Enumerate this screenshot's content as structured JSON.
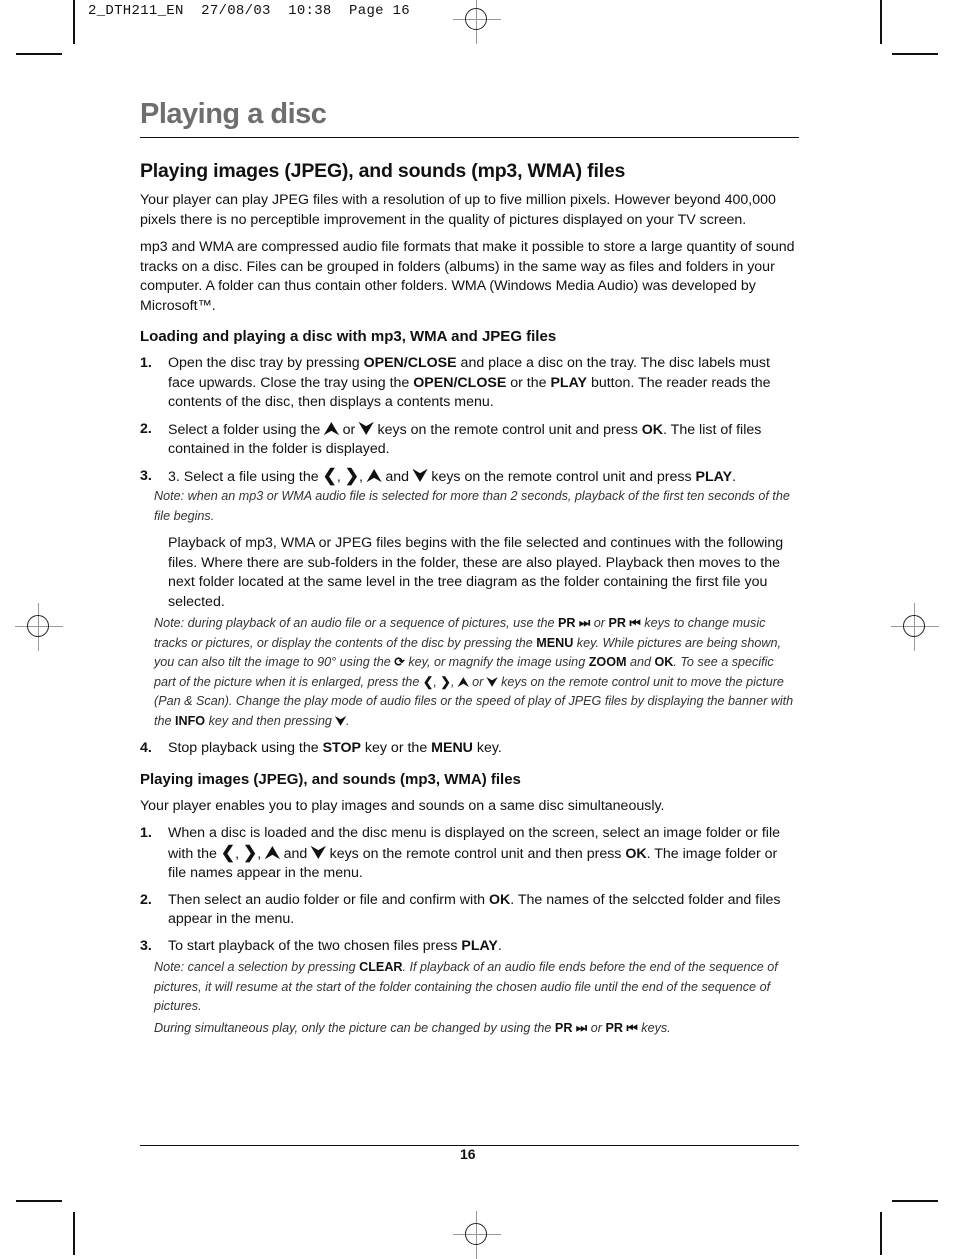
{
  "slug": "2_DTH211_EN  27/08/03  10:38  Page 16",
  "page_title": "Playing a disc",
  "section1": {
    "heading": "Playing images (JPEG), and sounds (mp3, WMA) files",
    "para1": "Your player can play JPEG files with a resolution of up to five million pixels. However beyond 400,000 pixels there is no perceptible improvement in the quality of pictures displayed on your TV screen.",
    "para2": "mp3 and WMA are compressed audio file formats that make it possible to store a large quantity of sound tracks on a disc. Files can be grouped in folders (albums) in the same way as files and folders in your computer. A folder can thus contain other folders. WMA (Windows Media Audio) was developed by Microsoft™."
  },
  "section2": {
    "heading": "Loading and playing a disc with mp3, WMA and JPEG files",
    "step1": {
      "num": "1.",
      "a": "Open the disc tray by pressing ",
      "k1": "OPEN/CLOSE",
      "b": " and place a disc on the tray. The disc labels must face upwards. Close the tray using the ",
      "k2": "OPEN/CLOSE",
      "c": " or the ",
      "k3": "PLAY",
      "d": " button. The reader reads the contents of the disc, then displays a contents menu."
    },
    "step2": {
      "num": "2.",
      "a": "Select a folder using the ",
      "up": "⮝",
      "or": " or ",
      "down": "⮟",
      "b": " keys on the remote control unit and press ",
      "k1": "OK",
      "c": ". The list of files contained in the folder is displayed."
    },
    "step3": {
      "num": "3.",
      "a": "3. Select a file using the ",
      "left": "❮",
      "right": "❯",
      "up": "⮝",
      "and": " and ",
      "down": "⮟",
      "b": " keys on the remote control unit and press ",
      "k1": "PLAY",
      "c": "."
    },
    "note1": "Note: when an mp3 or WMA audio file is selected for more than 2 seconds, playback of the first ten seconds of the file begins.",
    "para3": "Playback of mp3, WMA or JPEG files begins with the file selected and continues with the following files. Where there are sub-folders in the folder, these are also played. Playback then moves to the next folder located at the same level in the tree diagram as the folder containing the first file you selected.",
    "note2": {
      "a": "Note: during playback of an audio file or a sequence of pictures, use the ",
      "k1": "PR ⏭",
      "b": " or ",
      "k2": "PR ⏮",
      "c": " keys to change music tracks or pictures, or display the contents of the disc by pressing the ",
      "k3": "MENU",
      "d": " key. While pictures are being shown, you can also tilt the image to 90° using the ",
      "rotate_icon": "⟳",
      "e": " key, or magnify the image using ",
      "k4": "ZOOM",
      "f": " and ",
      "k5": "OK",
      "g": ". To see a specific part of the picture when it is enlarged, press the ",
      "left": "❮",
      "right": "❯",
      "up": "⮝",
      "or": " or ",
      "down": "⮟",
      "h": " keys on the remote control unit to move the picture (Pan & Scan). Change the play mode of audio files or the speed of play of JPEG files by displaying the banner with the ",
      "k6": "INFO",
      "i": " key and then pressing ",
      "j": "."
    },
    "step4": {
      "num": "4.",
      "a": "Stop playback using the ",
      "k1": "STOP",
      "b": " key or the ",
      "k2": "MENU",
      "c": " key."
    }
  },
  "section3": {
    "heading": "Playing images (JPEG), and sounds (mp3, WMA) files",
    "para": "Your player enables you to play images and sounds on a same disc simultaneously.",
    "step1": {
      "num": "1.",
      "a": "When a disc is loaded and the disc menu is displayed on the screen, select an image folder or file with the ",
      "left": "❮",
      "right": "❯",
      "up": "⮝",
      "and": " and ",
      "down": "⮟",
      "b": " keys on the remote control unit and then press ",
      "k1": "OK",
      "c": ". The image folder or file names appear in the menu."
    },
    "step2": {
      "num": "2.",
      "a": "Then select an audio folder or file and confirm with ",
      "k1": "OK",
      "b": ". The names of the selccted folder and files appear in the menu."
    },
    "step3": {
      "num": "3.",
      "a": "To start playback of the two chosen files press ",
      "k1": "PLAY",
      "b": "."
    },
    "note1": {
      "a": "Note: cancel a selection by pressing ",
      "k1": "CLEAR",
      "b": ". If playback of an audio file ends before the end of the sequence of pictures, it will resume at the start of the folder containing the chosen audio file until the end of the sequence of pictures."
    },
    "note2": {
      "a": "During simultaneous play, only the picture can be changed by using the ",
      "k1": "PR ⏭",
      "b": " or ",
      "k2": "PR ⏮",
      "c": " keys."
    }
  },
  "page_number": "16"
}
